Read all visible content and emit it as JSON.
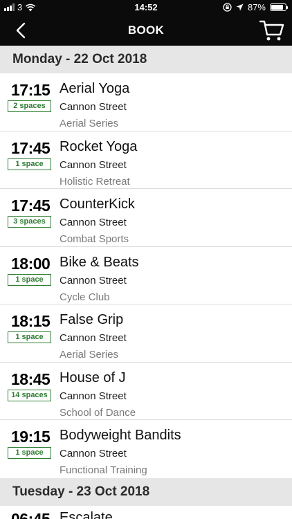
{
  "status_bar": {
    "carrier": "3",
    "time": "14:52",
    "battery": "87%",
    "battery_level": 0.87,
    "icons": [
      "signal-icon",
      "wifi-icon",
      "orientation-lock-icon",
      "location-icon",
      "battery-icon"
    ]
  },
  "nav": {
    "title": "BOOK",
    "back_icon": "chevron-left-icon",
    "cart_icon": "cart-icon"
  },
  "colors": {
    "topbar": "#0b0b0b",
    "section_bg": "#e6e6e6",
    "badge_green": "#2e7d32",
    "category_gray": "#7a7a7a"
  },
  "sections": [
    {
      "date": "Monday - 22 Oct 2018",
      "classes": [
        {
          "time": "17:15",
          "spaces": "2 spaces",
          "title": "Aerial Yoga",
          "location": "Cannon Street",
          "category": "Aerial Series"
        },
        {
          "time": "17:45",
          "spaces": "1 space",
          "title": "Rocket Yoga",
          "location": "Cannon Street",
          "category": "Holistic Retreat"
        },
        {
          "time": "17:45",
          "spaces": "3 spaces",
          "title": "CounterKick",
          "location": "Cannon Street",
          "category": "Combat Sports"
        },
        {
          "time": "18:00",
          "spaces": "1 space",
          "title": "Bike & Beats",
          "location": "Cannon Street",
          "category": "Cycle Club"
        },
        {
          "time": "18:15",
          "spaces": "1 space",
          "title": "False Grip",
          "location": "Cannon Street",
          "category": "Aerial Series"
        },
        {
          "time": "18:45",
          "spaces": "14 spaces",
          "title": "House of J",
          "location": "Cannon Street",
          "category": "School of Dance"
        },
        {
          "time": "19:15",
          "spaces": "1 space",
          "title": "Bodyweight Bandits",
          "location": "Cannon Street",
          "category": "Functional Training"
        }
      ]
    },
    {
      "date": "Tuesday - 23 Oct 2018",
      "classes": [
        {
          "time": "06:45",
          "spaces": "",
          "title": "Escalate",
          "location": "",
          "category": ""
        }
      ]
    }
  ]
}
